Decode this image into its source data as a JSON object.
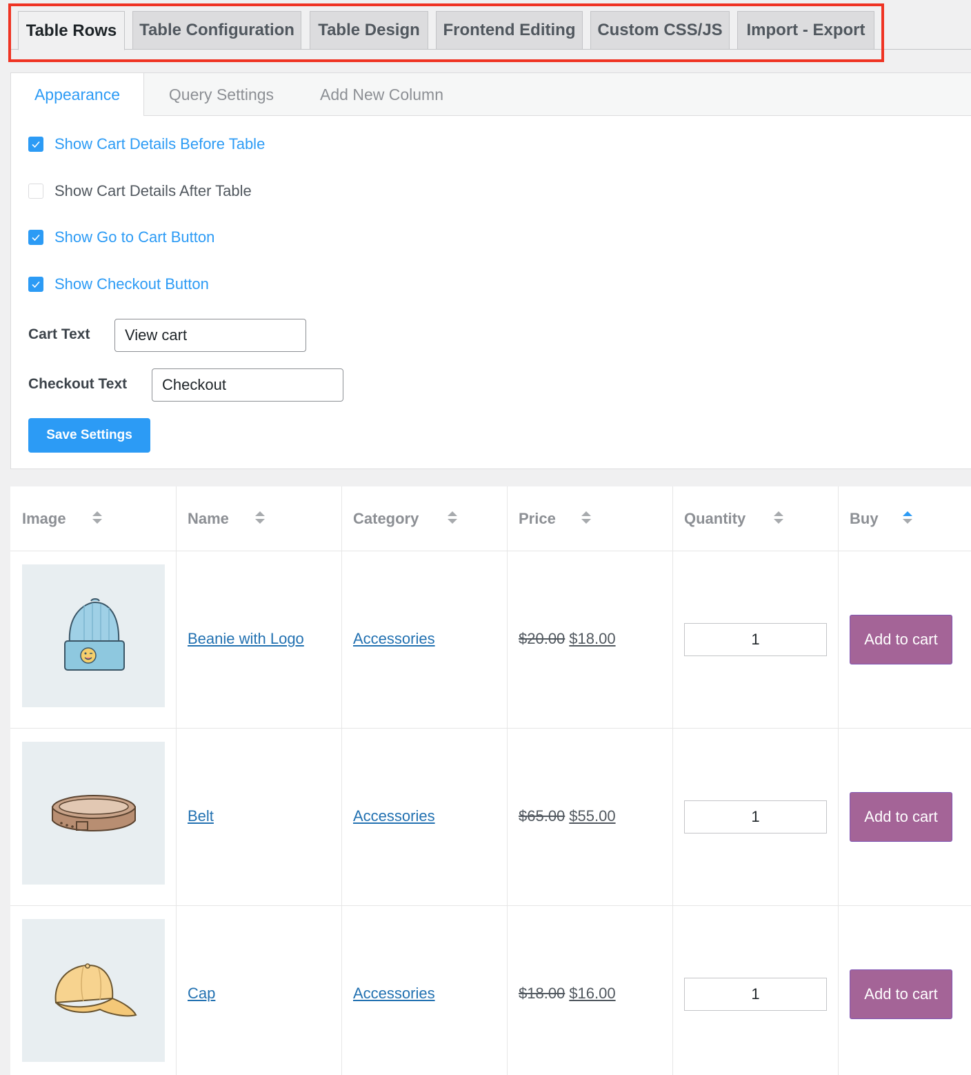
{
  "top_tabs": [
    {
      "label": "Table Rows",
      "active": true
    },
    {
      "label": "Table Configuration",
      "active": false
    },
    {
      "label": "Table Design",
      "active": false
    },
    {
      "label": "Frontend Editing",
      "active": false
    },
    {
      "label": "Custom CSS/JS",
      "active": false
    },
    {
      "label": "Import - Export",
      "active": false
    }
  ],
  "sub_tabs": [
    {
      "label": "Appearance",
      "active": true
    },
    {
      "label": "Query Settings",
      "active": false
    },
    {
      "label": "Add New Column",
      "active": false
    }
  ],
  "options": [
    {
      "label": "Show Cart Details Before Table",
      "checked": true
    },
    {
      "label": "Show Cart Details After Table",
      "checked": false
    },
    {
      "label": "Show Go to Cart Button",
      "checked": true
    },
    {
      "label": "Show Checkout Button",
      "checked": true
    }
  ],
  "fields": {
    "cart_text": {
      "label": "Cart Text",
      "value": "View cart"
    },
    "checkout_text": {
      "label": "Checkout Text",
      "value": "Checkout"
    }
  },
  "save_button": "Save Settings",
  "table": {
    "columns": [
      "Image",
      "Name",
      "Category",
      "Price",
      "Quantity",
      "Buy"
    ],
    "rows": [
      {
        "image_icon": "beanie-image",
        "name": "Beanie with Logo",
        "category": "Accessories",
        "old_price": "$20.00",
        "price": "$18.00",
        "quantity": "1",
        "button": "Add to cart"
      },
      {
        "image_icon": "belt-image",
        "name": "Belt",
        "category": "Accessories",
        "old_price": "$65.00",
        "price": "$55.00",
        "quantity": "1",
        "button": "Add to cart"
      },
      {
        "image_icon": "cap-image",
        "name": "Cap",
        "category": "Accessories",
        "old_price": "$18.00",
        "price": "$16.00",
        "quantity": "1",
        "button": "Add to cart"
      }
    ]
  },
  "colors": {
    "accent_blue": "#2c9bf5",
    "link_blue": "#2271b1",
    "add_to_cart_purple": "#a46497",
    "highlight_red": "#ef3323"
  }
}
